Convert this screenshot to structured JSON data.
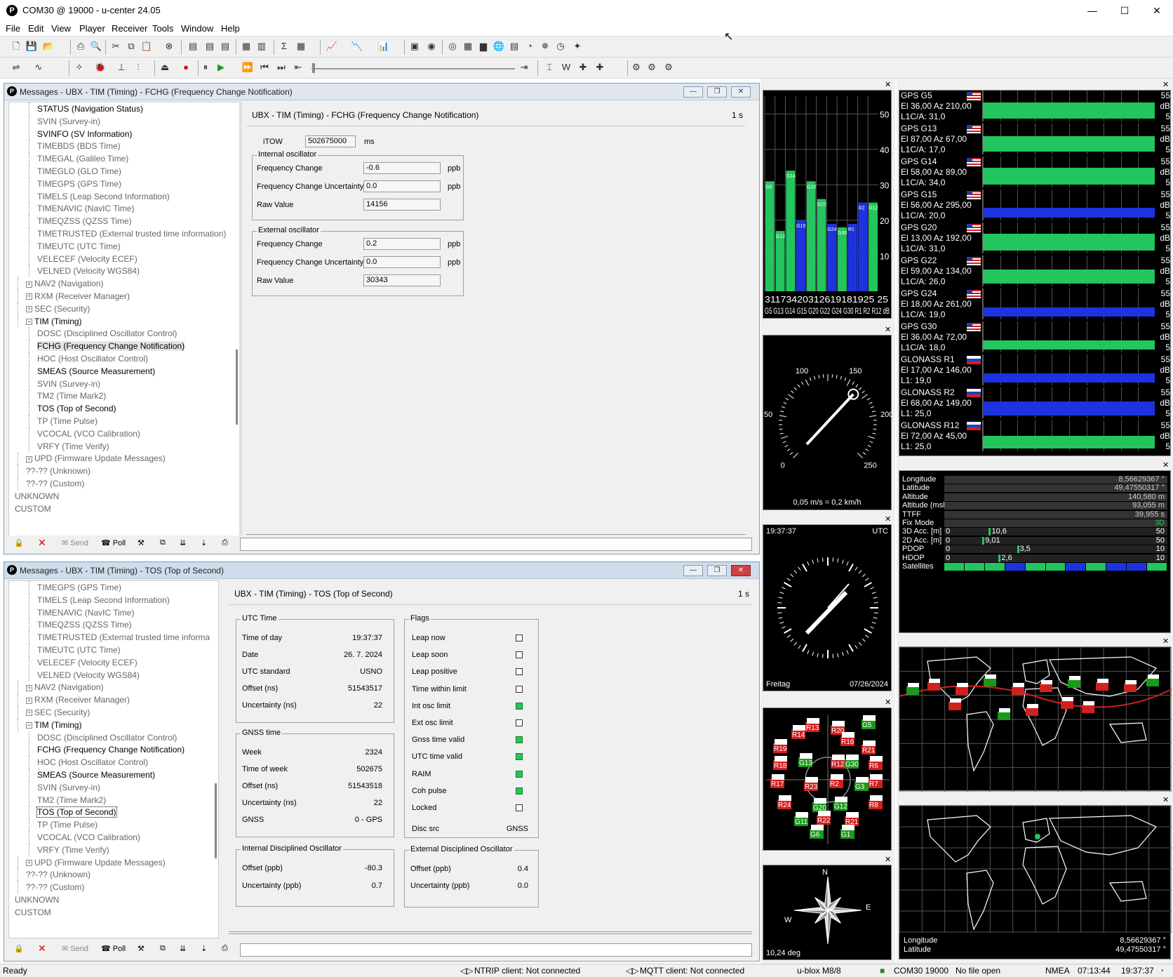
{
  "window": {
    "title": "COM30 @ 19000 - u-center 24.05",
    "min": "—",
    "max": "☐",
    "close": "✕"
  },
  "menu": [
    "File",
    "Edit",
    "View",
    "Player",
    "Receiver",
    "Tools",
    "Window",
    "Help"
  ],
  "top_window": {
    "title": "Messages - UBX - TIM (Timing) - FCHG (Frequency Change Notification)",
    "tree": [
      {
        "label": "STATUS (Navigation Status)",
        "style": "bold",
        "indent": 2
      },
      {
        "label": "SVIN (Survey-in)",
        "style": "dim",
        "indent": 2
      },
      {
        "label": "SVINFO (SV Information)",
        "style": "bold",
        "indent": 2
      },
      {
        "label": "TIMEBDS (BDS Time)",
        "style": "dim",
        "indent": 2
      },
      {
        "label": "TIMEGAL (Galileo Time)",
        "style": "dim",
        "indent": 2
      },
      {
        "label": "TIMEGLO (GLO Time)",
        "style": "dim",
        "indent": 2
      },
      {
        "label": "TIMEGPS (GPS Time)",
        "style": "dim",
        "indent": 2
      },
      {
        "label": "TIMELS (Leap Second Information)",
        "style": "dim",
        "indent": 2
      },
      {
        "label": "TIMENAVIC (NavIC Time)",
        "style": "dim",
        "indent": 2
      },
      {
        "label": "TIMEQZSS (QZSS Time)",
        "style": "dim",
        "indent": 2
      },
      {
        "label": "TIMETRUSTED (External trusted time information)",
        "style": "dim",
        "indent": 2
      },
      {
        "label": "TIMEUTC (UTC Time)",
        "style": "dim",
        "indent": 2
      },
      {
        "label": "VELECEF (Velocity ECEF)",
        "style": "dim",
        "indent": 2
      },
      {
        "label": "VELNED (Velocity WGS84)",
        "style": "dim",
        "indent": 2
      },
      {
        "label": "NAV2 (Navigation)",
        "style": "dim",
        "indent": 1,
        "exp": "+"
      },
      {
        "label": "RXM (Receiver Manager)",
        "style": "dim",
        "indent": 1,
        "exp": "+"
      },
      {
        "label": "SEC (Security)",
        "style": "dim",
        "indent": 1,
        "exp": "+"
      },
      {
        "label": "TIM (Timing)",
        "style": "bold",
        "indent": 1,
        "exp": "−"
      },
      {
        "label": "DOSC (Disciplined Oscillator Control)",
        "style": "dim",
        "indent": 2
      },
      {
        "label": "FCHG (Frequency Change Notification)",
        "style": "bold",
        "indent": 2,
        "hl": true
      },
      {
        "label": "HOC (Host Oscillator Control)",
        "style": "dim",
        "indent": 2
      },
      {
        "label": "SMEAS (Source Measurement)",
        "style": "bold",
        "indent": 2
      },
      {
        "label": "SVIN (Survey-in)",
        "style": "dim",
        "indent": 2
      },
      {
        "label": "TM2 (Time Mark2)",
        "style": "dim",
        "indent": 2
      },
      {
        "label": "TOS (Top of Second)",
        "style": "bold",
        "indent": 2
      },
      {
        "label": "TP (Time Pulse)",
        "style": "dim",
        "indent": 2
      },
      {
        "label": "VCOCAL (VCO Calibration)",
        "style": "dim",
        "indent": 2
      },
      {
        "label": "VRFY (Time Verify)",
        "style": "dim",
        "indent": 2
      },
      {
        "label": "UPD (Firmware Update Messages)",
        "style": "dim",
        "indent": 1,
        "exp": "+"
      },
      {
        "label": "??-?? (Unknown)",
        "style": "dim",
        "indent": 1
      },
      {
        "label": "??-?? (Custom)",
        "style": "dim",
        "indent": 1
      },
      {
        "label": "UNKNOWN",
        "style": "dim",
        "indent": 0
      },
      {
        "label": "CUSTOM",
        "style": "dim",
        "indent": 0
      }
    ],
    "header": "UBX - TIM (Timing) - FCHG (Frequency Change Notification)",
    "rate": "1 s",
    "itow_label": "iTOW",
    "itow": "502675000",
    "itow_unit": "ms",
    "internal": {
      "caption": "Internal oscillator",
      "freq_label": "Frequency Change",
      "freq": "-0.6",
      "unc_label": "Frequency Change Uncertainty",
      "unc": "0.0",
      "raw_label": "Raw Value",
      "raw": "14156",
      "unit": "ppb"
    },
    "external": {
      "caption": "External oscillator",
      "freq_label": "Frequency Change",
      "freq": "0.2",
      "unc_label": "Frequency Change Uncertainty",
      "unc": "0.0",
      "raw_label": "Raw Value",
      "raw": "30343",
      "unit": "ppb"
    }
  },
  "bottom_window": {
    "title": "Messages - UBX - TIM (Timing) - TOS (Top of Second)",
    "tree": [
      {
        "label": "TIMEGPS (GPS Time)",
        "style": "dim",
        "indent": 2
      },
      {
        "label": "TIMELS (Leap Second Information)",
        "style": "dim",
        "indent": 2
      },
      {
        "label": "TIMENAVIC (NavIC Time)",
        "style": "dim",
        "indent": 2
      },
      {
        "label": "TIMEQZSS (QZSS Time)",
        "style": "dim",
        "indent": 2
      },
      {
        "label": "TIMETRUSTED (External trusted time informa",
        "style": "dim",
        "indent": 2
      },
      {
        "label": "TIMEUTC (UTC Time)",
        "style": "dim",
        "indent": 2
      },
      {
        "label": "VELECEF (Velocity ECEF)",
        "style": "dim",
        "indent": 2
      },
      {
        "label": "VELNED (Velocity WGS84)",
        "style": "dim",
        "indent": 2
      },
      {
        "label": "NAV2 (Navigation)",
        "style": "dim",
        "indent": 1,
        "exp": "+"
      },
      {
        "label": "RXM (Receiver Manager)",
        "style": "dim",
        "indent": 1,
        "exp": "+"
      },
      {
        "label": "SEC (Security)",
        "style": "dim",
        "indent": 1,
        "exp": "+"
      },
      {
        "label": "TIM (Timing)",
        "style": "bold",
        "indent": 1,
        "exp": "−"
      },
      {
        "label": "DOSC (Disciplined Oscillator Control)",
        "style": "dim",
        "indent": 2
      },
      {
        "label": "FCHG (Frequency Change Notification)",
        "style": "bold",
        "indent": 2
      },
      {
        "label": "HOC (Host Oscillator Control)",
        "style": "dim",
        "indent": 2
      },
      {
        "label": "SMEAS (Source Measurement)",
        "style": "bold",
        "indent": 2
      },
      {
        "label": "SVIN (Survey-in)",
        "style": "dim",
        "indent": 2
      },
      {
        "label": "TM2 (Time Mark2)",
        "style": "dim",
        "indent": 2
      },
      {
        "label": "TOS (Top of Second)",
        "style": "bold",
        "indent": 2,
        "sel": true
      },
      {
        "label": "TP (Time Pulse)",
        "style": "dim",
        "indent": 2
      },
      {
        "label": "VCOCAL (VCO Calibration)",
        "style": "dim",
        "indent": 2
      },
      {
        "label": "VRFY (Time Verify)",
        "style": "dim",
        "indent": 2
      },
      {
        "label": "UPD (Firmware Update Messages)",
        "style": "dim",
        "indent": 1,
        "exp": "+"
      },
      {
        "label": "??-?? (Unknown)",
        "style": "dim",
        "indent": 1
      },
      {
        "label": "??-?? (Custom)",
        "style": "dim",
        "indent": 1
      },
      {
        "label": "UNKNOWN",
        "style": "dim",
        "indent": 0
      },
      {
        "label": "CUSTOM",
        "style": "dim",
        "indent": 0
      }
    ],
    "header": "UBX - TIM (Timing) - TOS (Top of Second)",
    "rate": "1 s",
    "utc": {
      "caption": "UTC Time",
      "rows": [
        [
          "Time of day",
          "19:37:37"
        ],
        [
          "Date",
          "26. 7. 2024"
        ],
        [
          "UTC standard",
          "USNO"
        ],
        [
          "Offset (ns)",
          "51543517"
        ],
        [
          "Uncertainty (ns)",
          "22"
        ]
      ]
    },
    "gnss": {
      "caption": "GNSS time",
      "rows": [
        [
          "Week",
          "2324"
        ],
        [
          "Time of week",
          "502675"
        ],
        [
          "Offset (ns)",
          "51543518"
        ],
        [
          "Uncertainty (ns)",
          "22"
        ],
        [
          "GNSS",
          "0 - GPS"
        ]
      ]
    },
    "flags": {
      "caption": "Flags",
      "rows": [
        [
          "Leap now",
          false
        ],
        [
          "Leap soon",
          false
        ],
        [
          "Leap positive",
          false
        ],
        [
          "Time within limit",
          false
        ],
        [
          "Int osc limit",
          true
        ],
        [
          "Ext osc limit",
          false
        ],
        [
          "Gnss time valid",
          true
        ],
        [
          "UTC time valid",
          true
        ],
        [
          "RAIM",
          true
        ],
        [
          "Coh pulse",
          true
        ],
        [
          "Locked",
          false
        ]
      ],
      "disc_label": "Disc src",
      "disc": "GNSS"
    },
    "ido": {
      "caption": "Internal Disciplined Oscillator",
      "rows": [
        [
          "Offset (ppb)",
          "-80.3"
        ],
        [
          "Uncertainty (ppb)",
          "0.7"
        ]
      ]
    },
    "edo": {
      "caption": "External Disciplined Oscillator",
      "rows": [
        [
          "Offset (ppb)",
          "0.4"
        ],
        [
          "Uncertainty (ppb)",
          "0.0"
        ]
      ]
    }
  },
  "msg_toolbar": {
    "send": "Send",
    "poll": "Poll"
  },
  "cno_chart": {
    "y_ticks": [
      "50",
      "40",
      "30",
      "20",
      "10"
    ],
    "bars": [
      {
        "value": 31,
        "label": "G5",
        "color": "green"
      },
      {
        "value": 17,
        "label": "G13",
        "color": "green"
      },
      {
        "value": 34,
        "label": "G14",
        "color": "green"
      },
      {
        "value": 20,
        "label": "G15",
        "color": "blue"
      },
      {
        "value": 31,
        "label": "G20",
        "color": "green"
      },
      {
        "value": 26,
        "label": "G22",
        "color": "green"
      },
      {
        "value": 19,
        "label": "G24",
        "color": "blue"
      },
      {
        "value": 18,
        "label": "G30",
        "color": "green"
      },
      {
        "value": 19,
        "label": "R1",
        "color": "blue"
      },
      {
        "value": 25,
        "label": "R2",
        "color": "blue"
      },
      {
        "value": 25,
        "label": "R12",
        "color": "green"
      }
    ],
    "values_text": "31173420312619181925 25",
    "labels_text": "G5 G13 G14 G15 G20 G22 G24 G30 R1 R2 R12 dB"
  },
  "speed": {
    "ticks": [
      "0",
      "50",
      "100",
      "150",
      "200",
      "250"
    ],
    "readout": "0,05 m/s = 0,2 km/h"
  },
  "clock": {
    "time": "19:37:37",
    "zone": "UTC",
    "day": "Freitag",
    "date": "07/26/2024"
  },
  "compass": {
    "n": "N",
    "e": "E",
    "w": "W",
    "heading": "10,24 deg"
  },
  "sv_list": [
    {
      "name": "GPS G5",
      "pos": "El 36,00 Az 210,00",
      "sig": "L1C/A: 31,0",
      "flag": "us",
      "color": "green",
      "level": 0.52
    },
    {
      "name": "GPS G13",
      "pos": "El 87,00 Az 67,00",
      "sig": "L1C/A: 17,0",
      "flag": "us",
      "color": "green",
      "level": 0.5
    },
    {
      "name": "GPS G14",
      "pos": "El 58,00 Az 89,00",
      "sig": "L1C/A: 34,0",
      "flag": "us",
      "color": "green",
      "level": 0.55
    },
    {
      "name": "GPS G15",
      "pos": "El 56,00 Az 295,00",
      "sig": "L1C/A: 20,0",
      "flag": "us",
      "color": "blue",
      "level": 0.32
    },
    {
      "name": "GPS G20",
      "pos": "El 13,00 Az 192,00",
      "sig": "L1C/A: 31,0",
      "flag": "us",
      "color": "green",
      "level": 0.55
    },
    {
      "name": "GPS G22",
      "pos": "El 59,00 Az 134,00",
      "sig": "L1C/A: 26,0",
      "flag": "us",
      "color": "green",
      "level": 0.45
    },
    {
      "name": "GPS G24",
      "pos": "El 18,00 Az 261,00",
      "sig": "L1C/A: 19,0",
      "flag": "us",
      "color": "blue",
      "level": 0.3
    },
    {
      "name": "GPS G30",
      "pos": "El 36,00 Az 72,00",
      "sig": "L1C/A: 18,0",
      "flag": "us",
      "color": "green",
      "level": 0.3
    },
    {
      "name": "GLONASS R1",
      "pos": "El 17,00 Az 146,00",
      "sig": "L1: 19,0",
      "flag": "ru",
      "color": "blue",
      "level": 0.3
    },
    {
      "name": "GLONASS R2",
      "pos": "El 68,00 Az 149,00",
      "sig": "L1: 25,0",
      "flag": "ru",
      "color": "blue",
      "level": 0.45
    },
    {
      "name": "GLONASS R12",
      "pos": "El 72,00 Az 45,00",
      "sig": "L1: 25,0",
      "flag": "ru",
      "color": "green",
      "level": 0.4
    }
  ],
  "sv_db": {
    "top": "55",
    "unit": "dB",
    "bottom": "5"
  },
  "nav": {
    "rows": [
      [
        "Longitude",
        "8,56629367 °"
      ],
      [
        "Latitude",
        "49,47550317 °"
      ],
      [
        "Altitude",
        "140,580 m"
      ],
      [
        "Altitude (msl)",
        "93,055 m"
      ],
      [
        "TTFF",
        "39,955 s"
      ],
      [
        "Fix Mode",
        "3D"
      ]
    ],
    "acc": [
      {
        "label": "3D Acc. [m]",
        "min": "0",
        "max": "50",
        "val": "10,6",
        "frac": 0.212
      },
      {
        "label": "2D Acc. [m]",
        "min": "0",
        "max": "50",
        "val": "9,01",
        "frac": 0.18
      },
      {
        "label": "PDOP",
        "min": "0",
        "max": "10",
        "val": "3,5",
        "frac": 0.35
      },
      {
        "label": "HDOP",
        "min": "0",
        "max": "10",
        "val": "2,6",
        "frac": 0.26
      }
    ],
    "sat_label": "Satellites",
    "sat_colors": [
      "#22c55e",
      "#22c55e",
      "#22c55e",
      "#1d33e0",
      "#22c55e",
      "#22c55e",
      "#1d33e0",
      "#22c55e",
      "#1d33e0",
      "#1d33e0",
      "#22c55e"
    ]
  },
  "map2": {
    "lon_label": "Longitude",
    "lon": "8,56629367 °",
    "lat_label": "Latitude",
    "lat": "49,47550317 °"
  },
  "statusbar": {
    "ready": "Ready",
    "ntrip": "NTRIP client: Not connected",
    "mqtt": "MQTT client: Not connected",
    "receiver": "u-blox M8/8",
    "port": "COM30 19000",
    "file": "No file open",
    "proto": "NMEA",
    "t1": "07:13:44",
    "t2": "19:37:37"
  },
  "colors": {
    "green": "#22c55e",
    "blue": "#1d33e0",
    "red": "#e02020"
  }
}
